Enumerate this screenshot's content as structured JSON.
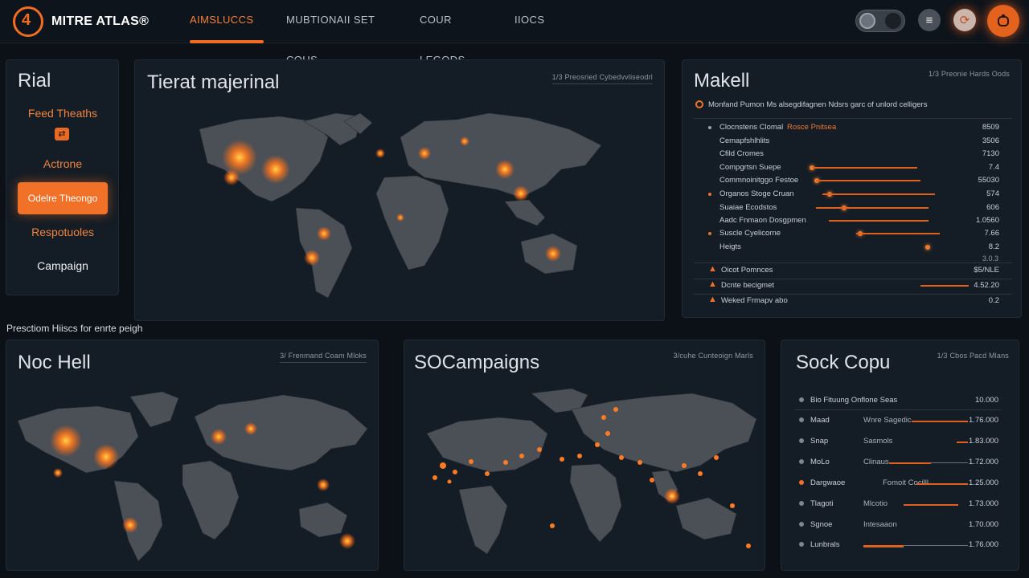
{
  "app": {
    "brand": "MITRE ATLAS®",
    "logo_glyph": "4"
  },
  "nav": {
    "tabs": [
      "AIMSLUCCS",
      "MUBTIONAII SET COUS",
      "COUR LEGODS",
      "IIOCS"
    ],
    "active_index": 0
  },
  "header_icons": [
    "theme-toggle-icon",
    "menu-icon",
    "history-icon",
    "user-avatar-icon"
  ],
  "side_menu": {
    "title": "Rial",
    "items": [
      "Feed Theaths",
      "Actrone",
      "Odelre Theongo",
      "Respotuoles",
      "Campaign"
    ],
    "active_index": 2
  },
  "threat_map": {
    "title": "Tierat majerinal",
    "meta": "1/3 Preosried Cybedvvliseodrl"
  },
  "makell": {
    "title": "Makell",
    "meta": "1/3 Preonie Hards Oods",
    "subtitle": "Monfand Pumon Ms alsegdifagnen Ndsrs garc of unlord celligers",
    "rows": [
      {
        "label": "Clocnstens Clomal",
        "highlight": "Rosce Pnitsea",
        "value": "8509"
      },
      {
        "label": "Cemapfshlhlits",
        "highlight": "",
        "value": "3506"
      },
      {
        "label": "Cfild Cromes",
        "highlight": "",
        "value": "7130"
      },
      {
        "label": "Compgrtsn Suepe",
        "highlight": "",
        "value": "7.4"
      },
      {
        "label": "Commnoinitggo Festoe",
        "highlight": "",
        "value": "55030"
      },
      {
        "label": "Organos Stoge Cruan",
        "highlight": "",
        "value": "574"
      },
      {
        "label": "Suaiae Ecodstos",
        "highlight": "",
        "value": "606"
      },
      {
        "label": "Aadc Fnmaon Dosgpmen",
        "highlight": "",
        "value": "1.0560"
      },
      {
        "label": "Suscle Cyelicorne",
        "highlight": "",
        "value": "7.66"
      },
      {
        "label": "Heigts",
        "highlight": "",
        "value": "8.2"
      }
    ],
    "footer_extra": "3.0.3",
    "alerts": [
      {
        "label": "Oicot Pomnces",
        "value": "$5/NLE"
      },
      {
        "label": "Dcnte becigmet",
        "value": "4.52.20"
      },
      {
        "label": "Weked Frmapv abo",
        "value": "0.2"
      }
    ]
  },
  "caption": "Presctiom Hiiscs for enrte peigh",
  "noc_panel": {
    "title": "Noc Hell",
    "meta": "3/ Frenmand Coam Mloks"
  },
  "soc_panel": {
    "title": "SOCampaigns",
    "meta": "3/cuhe Cunteoign Marls"
  },
  "sock_panel": {
    "title": "Sock Copu",
    "meta": "1/3 Cbos Pacd Mlans",
    "header_row": {
      "label": "Bio Fituung Onflone Seas",
      "value": "10.000"
    },
    "rows": [
      {
        "label": "Maad",
        "mid": "Wnre Sagedic",
        "value": "1.76.000"
      },
      {
        "label": "Snap",
        "mid": "Sasmols",
        "value": "1.83.000"
      },
      {
        "label": "MoLo",
        "mid": "Clinaus",
        "value": "1.72.000"
      },
      {
        "label": "Dargwaoe",
        "mid": "Fomoit Cocilll",
        "value": "1.25.000"
      },
      {
        "label": "Tlagoti",
        "mid": "Mlcotio",
        "value": "1.73.000"
      },
      {
        "label": "Sgnoe",
        "mid": "Intesaaon",
        "value": "1.70.000"
      },
      {
        "label": "Lunbrals",
        "mid": "",
        "value": "1.76.000"
      }
    ]
  },
  "colors": {
    "accent": "#f07127",
    "background": "#0c1117",
    "panel": "#141c25",
    "land": "#4b4f56",
    "hotspot": "#ff8a2c"
  }
}
